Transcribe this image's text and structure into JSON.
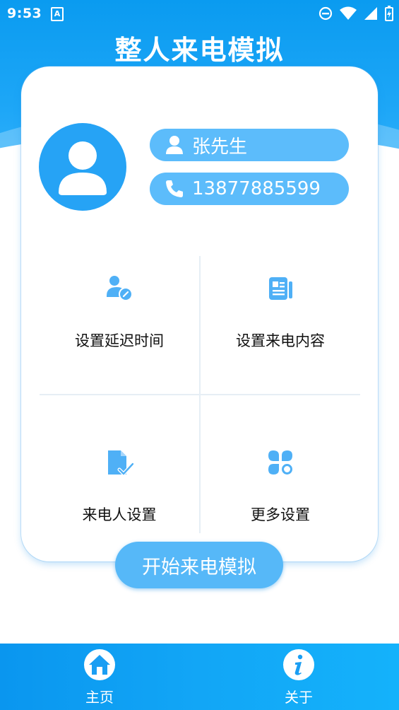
{
  "status_bar": {
    "time": "9:53",
    "notification_letter": "A"
  },
  "app": {
    "title": "整人来电模拟"
  },
  "caller": {
    "name": "张先生",
    "phone": "13877885599"
  },
  "menu": {
    "items": [
      {
        "label": "设置延迟时间",
        "icon": "user-clock-icon"
      },
      {
        "label": "设置来电内容",
        "icon": "document-icon"
      },
      {
        "label": "来电人设置",
        "icon": "file-edit-icon"
      },
      {
        "label": "更多设置",
        "icon": "apps-icon"
      }
    ]
  },
  "start_button_label": "开始来电模拟",
  "bottom_nav": {
    "items": [
      {
        "label": "主页",
        "icon": "home-icon"
      },
      {
        "label": "关于",
        "icon": "info-icon"
      }
    ]
  },
  "colors": {
    "primary": "#1ea7f7",
    "pill": "#5cbcfb",
    "avatar": "#26a3f5",
    "icon": "#4fb0f6"
  }
}
